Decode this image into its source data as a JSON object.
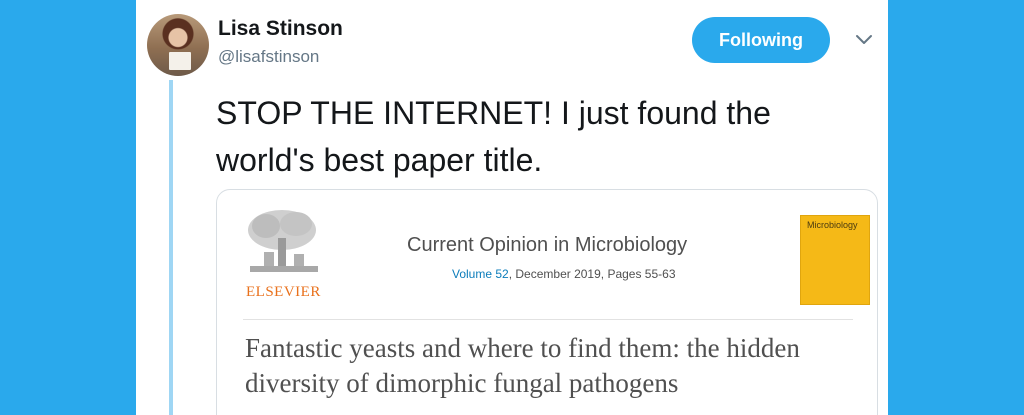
{
  "author": {
    "display_name": "Lisa Stinson",
    "handle": "@lisafstinson"
  },
  "follow_button_label": "Following",
  "menu_icon": "chevron-down-icon",
  "tweet_text": "STOP THE INTERNET! I just found the world's best paper title.",
  "card": {
    "publisher": "ELSEVIER",
    "journal": "Current Opinion in Microbiology",
    "volume_label": "Volume 52",
    "volume_details": ", December 2019, Pages 55-63",
    "cover_title": "Microbiology",
    "paper_title": "Fantastic yeasts and where to find them: the hidden diversity of dimorphic fungal pathogens"
  },
  "colors": {
    "background": "#2aa9ec",
    "button": "#2aa9ec",
    "thread_line": "#9fd6f4",
    "elsevier_orange": "#e9711c",
    "cover_yellow": "#f5b917",
    "link_blue": "#0c7dbb"
  }
}
